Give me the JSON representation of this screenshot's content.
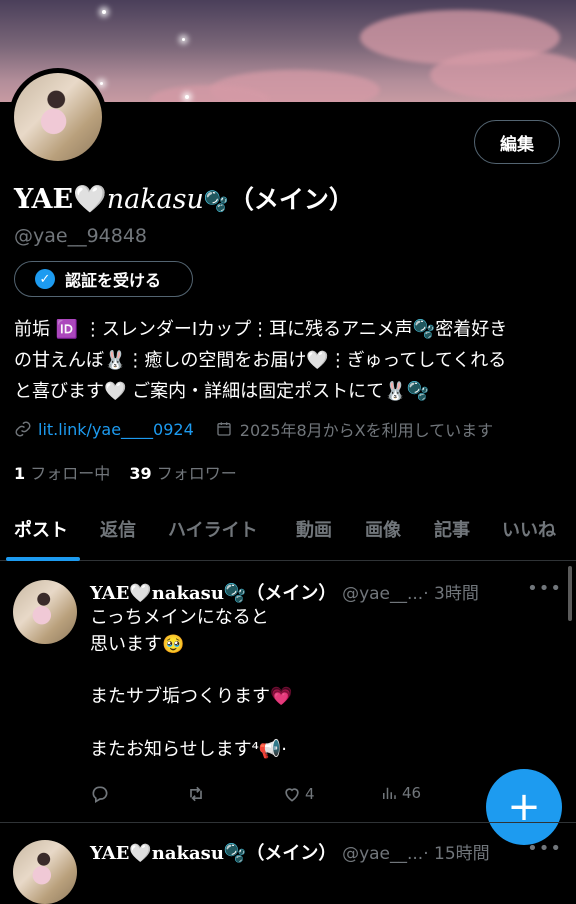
{
  "profile": {
    "name_plain": "YAE",
    "name_italic": "nakasu",
    "name_suffix": "（メイン）",
    "handle": "@yae__94848",
    "edit_label": "編集",
    "verify_label": "認証を受ける",
    "bio_line1": "前垢 🆔 ⋮スレンダーIカップ⋮耳に残るアニメ声🫧密着好き",
    "bio_line2": "の甘えんぼ🐰⋮癒しの空間をお届け🤍⋮ぎゅってしてくれる",
    "bio_line3": "と喜びます🤍 ご案内・詳細は固定ポストにて🐰🫧",
    "link": "lit.link/yae____0924",
    "joined": "2025年8月からXを利用しています",
    "following_count": "1",
    "following_label": "フォロー中",
    "followers_count": "39",
    "followers_label": "フォロワー"
  },
  "tabs": [
    "ポスト",
    "返信",
    "ハイライト",
    "動画",
    "画像",
    "記事",
    "いいね"
  ],
  "active_tab": "ポスト",
  "posts": [
    {
      "name": "YAE🤍nakasu🫧（メイン）",
      "handle": "@yae__...",
      "time": "· 3時間",
      "text_line1": "こっちメインになると",
      "text_line2": "思います🥹",
      "text_line3": "またサブ垢つくります💗",
      "text_line4": "またお知らせします⁴📢·",
      "likes": "4",
      "views": "46"
    },
    {
      "name": "YAE🤍nakasu🫧（メイン）",
      "handle": "@yae__...",
      "time": "· 15時間"
    }
  ],
  "colors": {
    "accent": "#1d9bf0",
    "background": "#000000",
    "muted": "#71767b"
  },
  "icons": [
    "link-icon",
    "calendar-icon",
    "reply-icon",
    "retweet-icon",
    "heart-icon",
    "views-icon",
    "more-icon",
    "plus-icon",
    "verified-check-icon"
  ]
}
